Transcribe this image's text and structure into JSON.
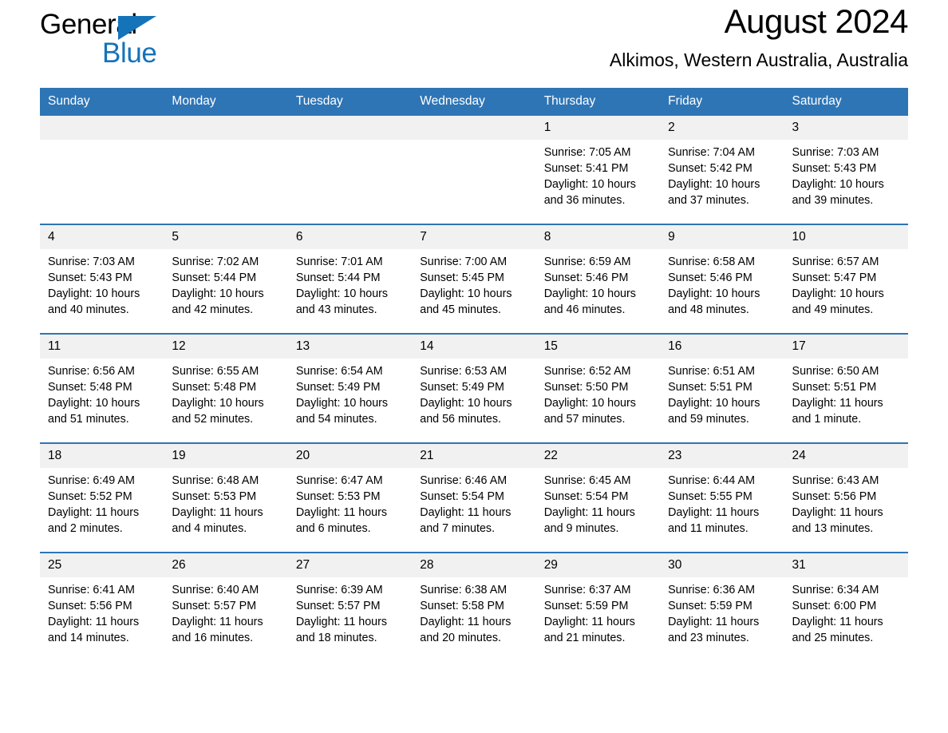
{
  "brand": {
    "name_part1": "General",
    "name_part2": "Blue",
    "logo_icon": "triangle-flag-icon",
    "accent_color": "#1573b9"
  },
  "header": {
    "title": "August 2024",
    "location": "Alkimos, Western Australia, Australia"
  },
  "colors": {
    "header_blue": "#2e75b6",
    "daynum_gray": "#f1f1f1",
    "text": "#000000"
  },
  "weekday_headers": [
    "Sunday",
    "Monday",
    "Tuesday",
    "Wednesday",
    "Thursday",
    "Friday",
    "Saturday"
  ],
  "weeks": [
    {
      "days": [
        {
          "date": "",
          "empty": true,
          "sunrise": "",
          "sunset": "",
          "daylight_line1": "",
          "daylight_line2": ""
        },
        {
          "date": "",
          "empty": true,
          "sunrise": "",
          "sunset": "",
          "daylight_line1": "",
          "daylight_line2": ""
        },
        {
          "date": "",
          "empty": true,
          "sunrise": "",
          "sunset": "",
          "daylight_line1": "",
          "daylight_line2": ""
        },
        {
          "date": "",
          "empty": true,
          "sunrise": "",
          "sunset": "",
          "daylight_line1": "",
          "daylight_line2": ""
        },
        {
          "date": "1",
          "empty": false,
          "sunrise": "Sunrise: 7:05 AM",
          "sunset": "Sunset: 5:41 PM",
          "daylight_line1": "Daylight: 10 hours",
          "daylight_line2": "and 36 minutes."
        },
        {
          "date": "2",
          "empty": false,
          "sunrise": "Sunrise: 7:04 AM",
          "sunset": "Sunset: 5:42 PM",
          "daylight_line1": "Daylight: 10 hours",
          "daylight_line2": "and 37 minutes."
        },
        {
          "date": "3",
          "empty": false,
          "sunrise": "Sunrise: 7:03 AM",
          "sunset": "Sunset: 5:43 PM",
          "daylight_line1": "Daylight: 10 hours",
          "daylight_line2": "and 39 minutes."
        }
      ]
    },
    {
      "days": [
        {
          "date": "4",
          "empty": false,
          "sunrise": "Sunrise: 7:03 AM",
          "sunset": "Sunset: 5:43 PM",
          "daylight_line1": "Daylight: 10 hours",
          "daylight_line2": "and 40 minutes."
        },
        {
          "date": "5",
          "empty": false,
          "sunrise": "Sunrise: 7:02 AM",
          "sunset": "Sunset: 5:44 PM",
          "daylight_line1": "Daylight: 10 hours",
          "daylight_line2": "and 42 minutes."
        },
        {
          "date": "6",
          "empty": false,
          "sunrise": "Sunrise: 7:01 AM",
          "sunset": "Sunset: 5:44 PM",
          "daylight_line1": "Daylight: 10 hours",
          "daylight_line2": "and 43 minutes."
        },
        {
          "date": "7",
          "empty": false,
          "sunrise": "Sunrise: 7:00 AM",
          "sunset": "Sunset: 5:45 PM",
          "daylight_line1": "Daylight: 10 hours",
          "daylight_line2": "and 45 minutes."
        },
        {
          "date": "8",
          "empty": false,
          "sunrise": "Sunrise: 6:59 AM",
          "sunset": "Sunset: 5:46 PM",
          "daylight_line1": "Daylight: 10 hours",
          "daylight_line2": "and 46 minutes."
        },
        {
          "date": "9",
          "empty": false,
          "sunrise": "Sunrise: 6:58 AM",
          "sunset": "Sunset: 5:46 PM",
          "daylight_line1": "Daylight: 10 hours",
          "daylight_line2": "and 48 minutes."
        },
        {
          "date": "10",
          "empty": false,
          "sunrise": "Sunrise: 6:57 AM",
          "sunset": "Sunset: 5:47 PM",
          "daylight_line1": "Daylight: 10 hours",
          "daylight_line2": "and 49 minutes."
        }
      ]
    },
    {
      "days": [
        {
          "date": "11",
          "empty": false,
          "sunrise": "Sunrise: 6:56 AM",
          "sunset": "Sunset: 5:48 PM",
          "daylight_line1": "Daylight: 10 hours",
          "daylight_line2": "and 51 minutes."
        },
        {
          "date": "12",
          "empty": false,
          "sunrise": "Sunrise: 6:55 AM",
          "sunset": "Sunset: 5:48 PM",
          "daylight_line1": "Daylight: 10 hours",
          "daylight_line2": "and 52 minutes."
        },
        {
          "date": "13",
          "empty": false,
          "sunrise": "Sunrise: 6:54 AM",
          "sunset": "Sunset: 5:49 PM",
          "daylight_line1": "Daylight: 10 hours",
          "daylight_line2": "and 54 minutes."
        },
        {
          "date": "14",
          "empty": false,
          "sunrise": "Sunrise: 6:53 AM",
          "sunset": "Sunset: 5:49 PM",
          "daylight_line1": "Daylight: 10 hours",
          "daylight_line2": "and 56 minutes."
        },
        {
          "date": "15",
          "empty": false,
          "sunrise": "Sunrise: 6:52 AM",
          "sunset": "Sunset: 5:50 PM",
          "daylight_line1": "Daylight: 10 hours",
          "daylight_line2": "and 57 minutes."
        },
        {
          "date": "16",
          "empty": false,
          "sunrise": "Sunrise: 6:51 AM",
          "sunset": "Sunset: 5:51 PM",
          "daylight_line1": "Daylight: 10 hours",
          "daylight_line2": "and 59 minutes."
        },
        {
          "date": "17",
          "empty": false,
          "sunrise": "Sunrise: 6:50 AM",
          "sunset": "Sunset: 5:51 PM",
          "daylight_line1": "Daylight: 11 hours",
          "daylight_line2": "and 1 minute."
        }
      ]
    },
    {
      "days": [
        {
          "date": "18",
          "empty": false,
          "sunrise": "Sunrise: 6:49 AM",
          "sunset": "Sunset: 5:52 PM",
          "daylight_line1": "Daylight: 11 hours",
          "daylight_line2": "and 2 minutes."
        },
        {
          "date": "19",
          "empty": false,
          "sunrise": "Sunrise: 6:48 AM",
          "sunset": "Sunset: 5:53 PM",
          "daylight_line1": "Daylight: 11 hours",
          "daylight_line2": "and 4 minutes."
        },
        {
          "date": "20",
          "empty": false,
          "sunrise": "Sunrise: 6:47 AM",
          "sunset": "Sunset: 5:53 PM",
          "daylight_line1": "Daylight: 11 hours",
          "daylight_line2": "and 6 minutes."
        },
        {
          "date": "21",
          "empty": false,
          "sunrise": "Sunrise: 6:46 AM",
          "sunset": "Sunset: 5:54 PM",
          "daylight_line1": "Daylight: 11 hours",
          "daylight_line2": "and 7 minutes."
        },
        {
          "date": "22",
          "empty": false,
          "sunrise": "Sunrise: 6:45 AM",
          "sunset": "Sunset: 5:54 PM",
          "daylight_line1": "Daylight: 11 hours",
          "daylight_line2": "and 9 minutes."
        },
        {
          "date": "23",
          "empty": false,
          "sunrise": "Sunrise: 6:44 AM",
          "sunset": "Sunset: 5:55 PM",
          "daylight_line1": "Daylight: 11 hours",
          "daylight_line2": "and 11 minutes."
        },
        {
          "date": "24",
          "empty": false,
          "sunrise": "Sunrise: 6:43 AM",
          "sunset": "Sunset: 5:56 PM",
          "daylight_line1": "Daylight: 11 hours",
          "daylight_line2": "and 13 minutes."
        }
      ]
    },
    {
      "days": [
        {
          "date": "25",
          "empty": false,
          "sunrise": "Sunrise: 6:41 AM",
          "sunset": "Sunset: 5:56 PM",
          "daylight_line1": "Daylight: 11 hours",
          "daylight_line2": "and 14 minutes."
        },
        {
          "date": "26",
          "empty": false,
          "sunrise": "Sunrise: 6:40 AM",
          "sunset": "Sunset: 5:57 PM",
          "daylight_line1": "Daylight: 11 hours",
          "daylight_line2": "and 16 minutes."
        },
        {
          "date": "27",
          "empty": false,
          "sunrise": "Sunrise: 6:39 AM",
          "sunset": "Sunset: 5:57 PM",
          "daylight_line1": "Daylight: 11 hours",
          "daylight_line2": "and 18 minutes."
        },
        {
          "date": "28",
          "empty": false,
          "sunrise": "Sunrise: 6:38 AM",
          "sunset": "Sunset: 5:58 PM",
          "daylight_line1": "Daylight: 11 hours",
          "daylight_line2": "and 20 minutes."
        },
        {
          "date": "29",
          "empty": false,
          "sunrise": "Sunrise: 6:37 AM",
          "sunset": "Sunset: 5:59 PM",
          "daylight_line1": "Daylight: 11 hours",
          "daylight_line2": "and 21 minutes."
        },
        {
          "date": "30",
          "empty": false,
          "sunrise": "Sunrise: 6:36 AM",
          "sunset": "Sunset: 5:59 PM",
          "daylight_line1": "Daylight: 11 hours",
          "daylight_line2": "and 23 minutes."
        },
        {
          "date": "31",
          "empty": false,
          "sunrise": "Sunrise: 6:34 AM",
          "sunset": "Sunset: 6:00 PM",
          "daylight_line1": "Daylight: 11 hours",
          "daylight_line2": "and 25 minutes."
        }
      ]
    }
  ]
}
